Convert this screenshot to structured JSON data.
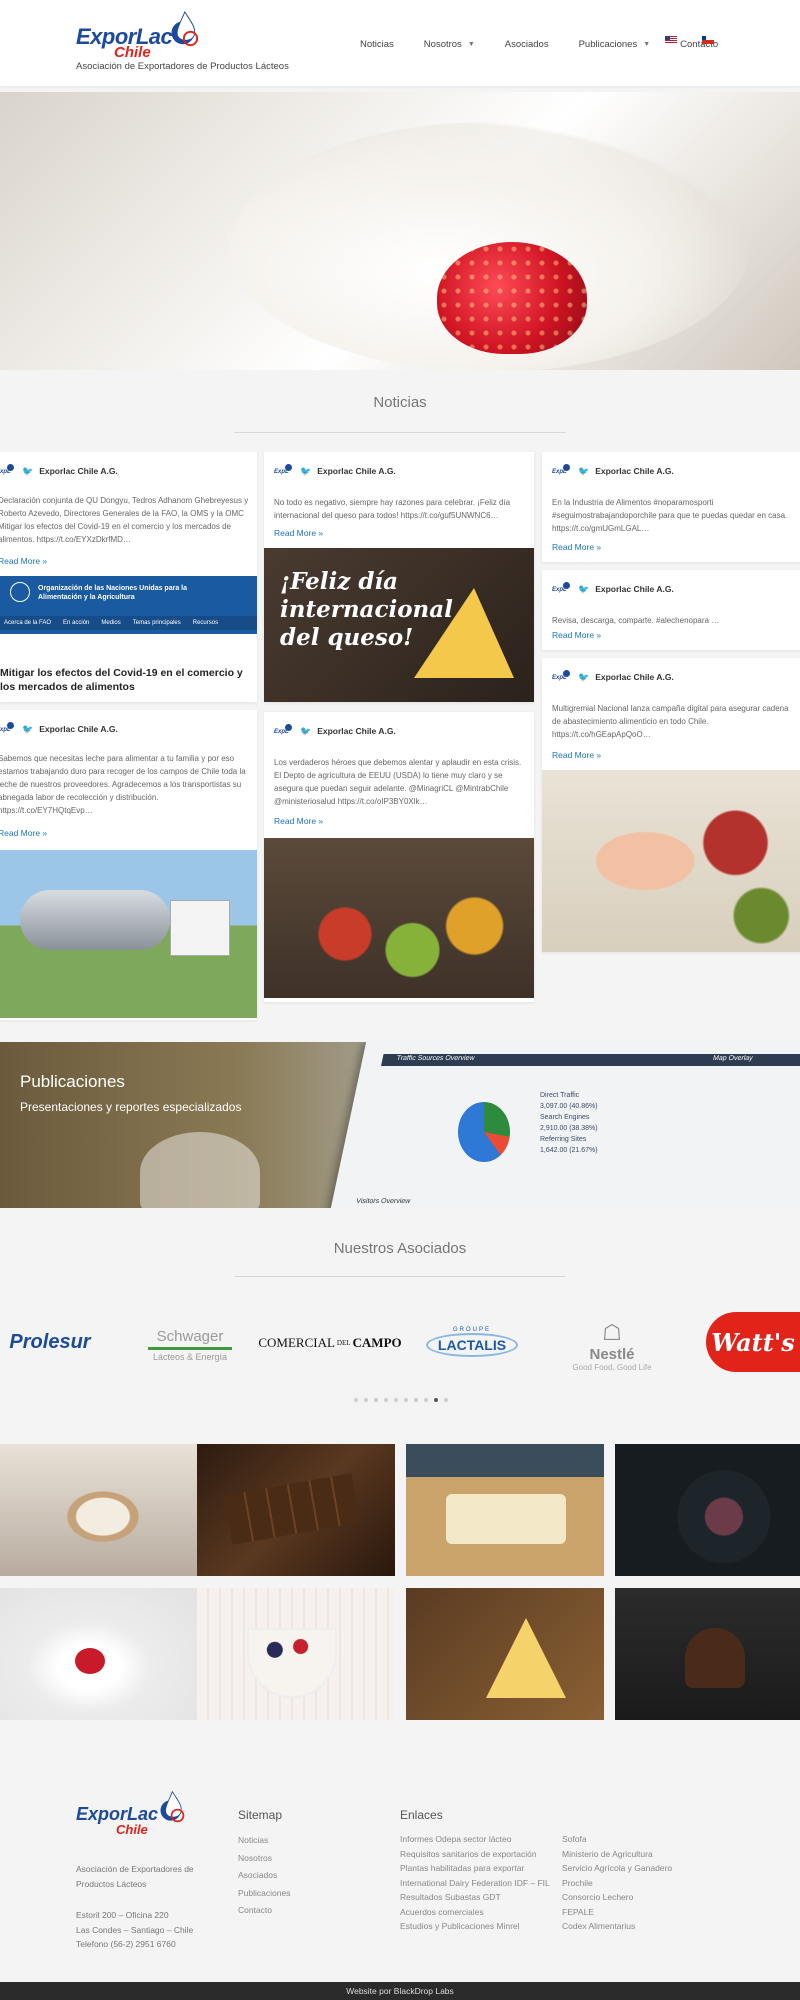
{
  "brand": {
    "name_top": "ExporLac",
    "name_bottom": "Chile",
    "tagline": "Asociación de Exportadores de Productos Lácteos"
  },
  "nav": [
    {
      "label": "Noticias",
      "has_caret": false
    },
    {
      "label": "Nosotros",
      "has_caret": true
    },
    {
      "label": "Asociados",
      "has_caret": false
    },
    {
      "label": "Publicaciones",
      "has_caret": true
    },
    {
      "label": "Contacto",
      "has_caret": false
    }
  ],
  "news": {
    "title": "Noticias",
    "account": "Exporlac Chile A.G.",
    "read_more": "Read More",
    "cards": [
      {
        "text": "Declaración conjunta de QU Dongyu, Tedros Adhanom Ghebreyesus y Roberto Azevedo, Directores Generales de la FAO, la OMS y la OMC Mitigar los efectos del Covid-19 en el comercio y los mercados de alimentos. https://t.co/EYXzDkrfMD…",
        "img_banner": "Organización de las Naciones Unidas para la Alimentación y la Agricultura",
        "img_menu": [
          "Acerca de la FAO",
          "En acción",
          "Medios",
          "Temas principales",
          "Recursos"
        ],
        "headline": "Mitigar los efectos del Covid-19 en el comercio y los mercados de alimentos"
      },
      {
        "text": "Sabemos que necesitas leche para alimentar a tu familia y por eso estamos trabajando duro para recoger de los campos de Chile toda la leche de nuestros proveedores. Agradecemos a los transportistas su abnegada labor de recolección y distribución. https://t.co/EY7HQtqEvp…"
      },
      {
        "text": "No todo es negativo, siempre hay razones para celebrar. ¡Feliz día internacional del queso para todos! https://t.co/guf5UNWNC6…",
        "img_text": "¡Feliz día internacional del queso!"
      },
      {
        "text": "Los verdaderos héroes que debemos alentar y aplaudir en esta crisis. El Depto de agricultura de EEUU (USDA) lo tiene muy claro y se asegura que puedan seguir adelante. @MinagriCL @MintrabChile @ministeriosalud https://t.co/oIP3BY0Xlk…"
      },
      {
        "text": "En la Industria de Alimentos #noparamosporti #seguimostrabajandoporchile para que te puedas quedar en casa. https://t.co/gmUGmLGAL…"
      },
      {
        "text": "Revisa, descarga, comparte. #alechenopara …"
      },
      {
        "text": "Multigremial Nacional lanza campaña digital para asegurar cadena de abastecimiento alimenticio en todo Chile. https://t.co/hGEapApQoO…"
      }
    ]
  },
  "publicaciones": {
    "title": "Publicaciones",
    "subtitle": "Presentaciones y reportes especializados",
    "tablet_header": "Traffic Sources Overview",
    "tablet_header2": "Map Overlay",
    "tablet_footer": "Visitors Overview",
    "legend": [
      {
        "label": "Direct Traffic",
        "value": "3,097.00 (40.86%)"
      },
      {
        "label": "Search Engines",
        "value": "2,910.00 (38.38%)"
      },
      {
        "label": "Referring Sites",
        "value": "1,642.00 (21.67%)"
      }
    ]
  },
  "asociados": {
    "title": "Nuestros Asociados",
    "logos": [
      {
        "name": "Prolesur"
      },
      {
        "name": "Schwager",
        "sub": "Lácteos & Energía"
      },
      {
        "name_a": "COMERCIAL",
        "name_b": "DEL",
        "name_c": "CAMPO"
      },
      {
        "name": "LACTALIS",
        "sup": "GROUPE"
      },
      {
        "name": "Nestlé",
        "sub": "Good Food, Good Life"
      },
      {
        "name": "Watt's"
      }
    ],
    "dot_count": 10,
    "dot_active": 8
  },
  "gallery": [
    {
      "subject": "latte-art"
    },
    {
      "subject": "chocolate"
    },
    {
      "subject": "cheese-board"
    },
    {
      "subject": "ice-cream"
    },
    {
      "subject": "milk-splash-strawberry"
    },
    {
      "subject": "yogurt-granola"
    },
    {
      "subject": "cheese-wedges"
    },
    {
      "subject": "cupcakes"
    }
  ],
  "footer": {
    "about": "Asociación de Exportadores de Productos Lácteos",
    "address": [
      "Estoril 200 – Oficina 220",
      "Las Condes – Santiago – Chile",
      "Telefono (56-2) 2951 6760"
    ],
    "sitemap_title": "Sitemap",
    "sitemap": [
      "Noticias",
      "Nosotros",
      "Asociados",
      "Publicaciones",
      "Contacto"
    ],
    "links_title": "Enlaces",
    "links_col1": [
      "Informes Odepa sector lácteo",
      "Requisitos sanitarios de exportación",
      "Plantas habilitadas para exportar",
      "International Dairy Federation IDF – FIL",
      "Resultados Subastas GDT",
      "Acuerdos comerciales",
      "Estudios y Publicaciones Minrel"
    ],
    "links_col2": [
      "Sofofa",
      "Ministerio de Agricultura",
      "Servicio Agrícola y Ganadero",
      "Prochile",
      "Consorcio Lechero",
      "FEPALE",
      "Codex Alimentarius"
    ],
    "credit": "Website por BlackDrop Labs"
  },
  "colors": {
    "brand_blue": "#1c4a9c",
    "brand_red": "#e2231a",
    "link": "#1a74c4",
    "twitter": "#1da1f2"
  }
}
